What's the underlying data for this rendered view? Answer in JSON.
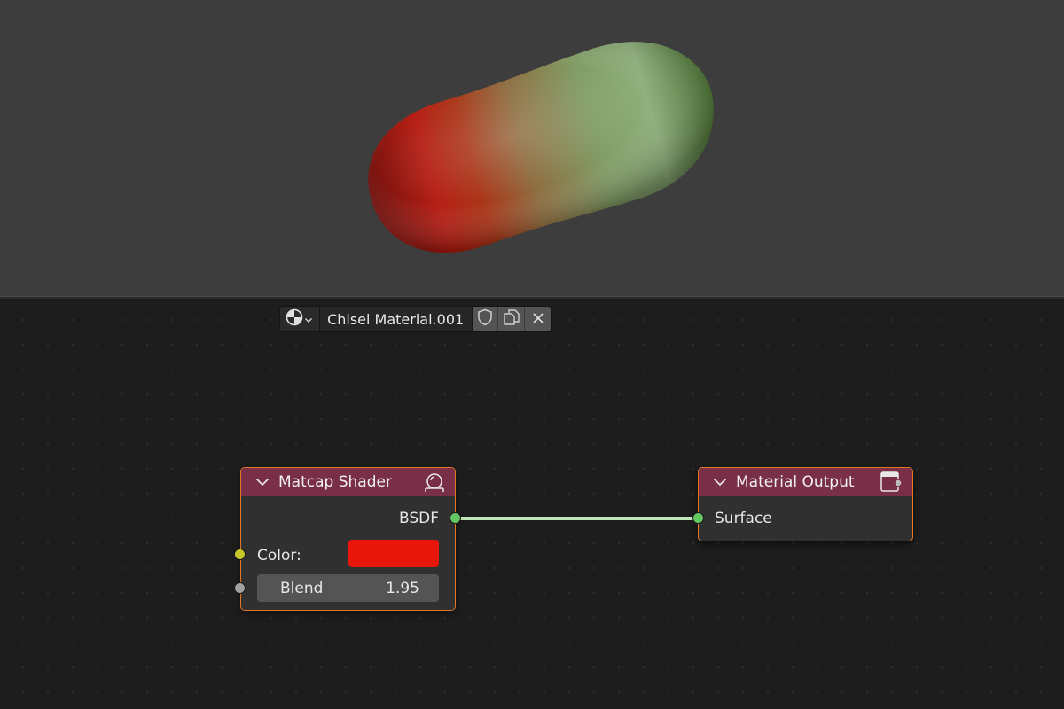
{
  "viewport": {
    "object_gradient": [
      "#a5130d",
      "#c25a3c",
      "#8fa870",
      "#4d7a35"
    ]
  },
  "material_bar": {
    "browse_icon": "material-sphere-icon",
    "material_name": "Chisel Material.001",
    "fake_user_icon": "shield-icon",
    "duplicate_icon": "duplicate-icon",
    "unlink_icon": "close-icon"
  },
  "nodes": {
    "matcap": {
      "title": "Matcap Shader",
      "header_icon": "matcap-icon",
      "output_label": "BSDF",
      "color_label": "Color:",
      "color_value": "#e8160a",
      "blend_label": "Blend",
      "blend_value": "1.95"
    },
    "output": {
      "title": "Material Output",
      "header_icon": "output-icon",
      "input_label": "Surface"
    }
  },
  "colors": {
    "node_header": "#7a2f48",
    "node_border_selected": "#e07828",
    "link": "#bfe8b8",
    "socket_shader": "#63c763",
    "socket_color": "#c7c729",
    "socket_float": "#a1a1a1"
  }
}
